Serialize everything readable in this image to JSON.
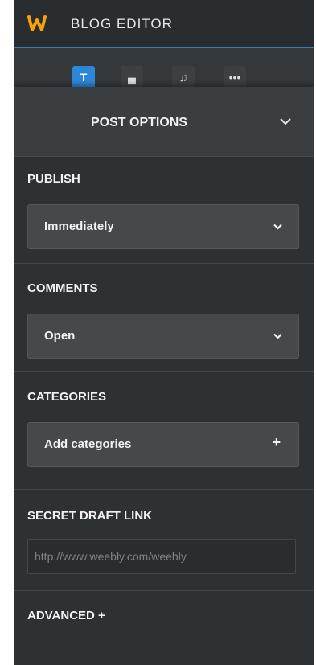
{
  "header": {
    "title": "BLOG EDITOR",
    "logo_color": "#f6a30b"
  },
  "toolbar": {
    "tools": [
      {
        "icon": "text-icon",
        "glyph": "T",
        "active": true
      },
      {
        "icon": "layout-icon",
        "glyph": "▄",
        "active": false
      },
      {
        "icon": "music-icon",
        "glyph": "♫",
        "active": false
      },
      {
        "icon": "more-icon",
        "glyph": "•••",
        "active": false
      }
    ]
  },
  "post_options": {
    "label": "POST OPTIONS"
  },
  "publish": {
    "label": "PUBLISH",
    "value": "Immediately"
  },
  "comments": {
    "label": "COMMENTS",
    "value": "Open"
  },
  "categories": {
    "label": "CATEGORIES",
    "button_label": "Add categories",
    "plus": "+"
  },
  "secret_link": {
    "label": "SECRET DRAFT LINK",
    "placeholder": "http://www.weebly.com/weebly"
  },
  "advanced": {
    "label": "ADVANCED  +"
  },
  "colors": {
    "panel_bg": "#2e3133",
    "accent": "#2d87d8"
  }
}
